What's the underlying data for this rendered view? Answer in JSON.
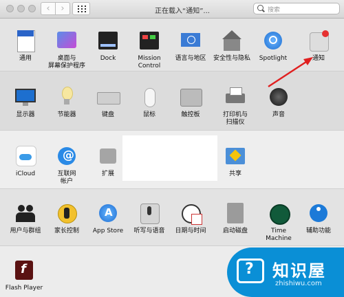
{
  "window": {
    "title": "正在载入“通知”..."
  },
  "search": {
    "placeholder": "搜索"
  },
  "rows": [
    [
      {
        "label": "通用",
        "icon": "general-file-icon"
      },
      {
        "label": "桌面与\n屏幕保护程序",
        "icon": "desktop-icon"
      },
      {
        "label": "Dock",
        "icon": "dock-icon"
      },
      {
        "label": "Mission\nControl",
        "icon": "mission-control-icon"
      },
      {
        "label": "语言与地区",
        "icon": "language-flag-icon"
      },
      {
        "label": "安全性与隐私",
        "icon": "security-house-icon"
      },
      {
        "label": "Spotlight",
        "icon": "spotlight-icon"
      },
      {
        "label": "通知",
        "icon": "notifications-icon"
      }
    ],
    [
      {
        "label": "显示器",
        "icon": "display-icon"
      },
      {
        "label": "节能器",
        "icon": "energy-bulb-icon"
      },
      {
        "label": "键盘",
        "icon": "keyboard-icon"
      },
      {
        "label": "鼠标",
        "icon": "mouse-icon"
      },
      {
        "label": "触控板",
        "icon": "trackpad-icon"
      },
      {
        "label": "打印机与\n扫描仪",
        "icon": "printer-icon"
      },
      {
        "label": "声音",
        "icon": "speaker-icon"
      }
    ],
    [
      {
        "label": "iCloud",
        "icon": "icloud-icon"
      },
      {
        "label": "互联网\n帐户",
        "icon": "internet-accounts-icon"
      },
      {
        "label": "扩展",
        "icon": "extensions-icon"
      },
      {
        "label": "共享",
        "icon": "sharing-icon"
      }
    ],
    [
      {
        "label": "用户与群组",
        "icon": "users-icon"
      },
      {
        "label": "家长控制",
        "icon": "parental-controls-icon"
      },
      {
        "label": "App Store",
        "icon": "app-store-icon"
      },
      {
        "label": "听写与语音",
        "icon": "dictation-mic-icon"
      },
      {
        "label": "日期与时间",
        "icon": "date-time-icon"
      },
      {
        "label": "启动磁盘",
        "icon": "startup-disk-icon"
      },
      {
        "label": "Time Machine",
        "icon": "time-machine-icon"
      },
      {
        "label": "辅助功能",
        "icon": "accessibility-icon"
      }
    ],
    [
      {
        "label": "Flash Player",
        "icon": "flash-player-icon"
      }
    ]
  ],
  "watermark": {
    "brand": "知识屋",
    "domain": "zhishiwu.com"
  }
}
